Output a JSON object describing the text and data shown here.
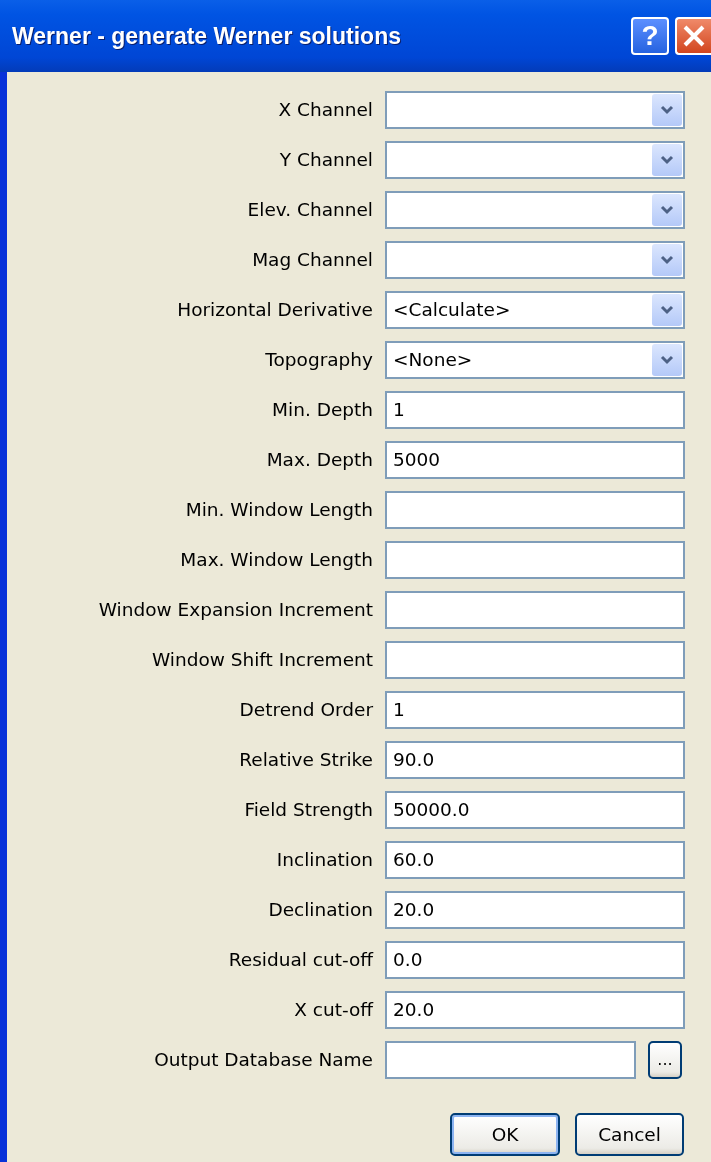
{
  "window": {
    "title": "Werner - generate Werner solutions",
    "help_button": "?"
  },
  "fields": [
    {
      "label": "X Channel",
      "kind": "combo"
    },
    {
      "label": "Y Channel",
      "kind": "combo"
    },
    {
      "label": "Elev. Channel",
      "kind": "combo"
    },
    {
      "label": "Mag Channel",
      "kind": "combo"
    },
    {
      "label": "Horizontal Derivative",
      "kind": "combo",
      "value": "<Calculate>"
    },
    {
      "label": "Topography",
      "kind": "combo",
      "value": "<None>"
    },
    {
      "label": "Min. Depth",
      "kind": "text",
      "value": "1"
    },
    {
      "label": "Max. Depth",
      "kind": "text",
      "value": "5000"
    },
    {
      "label": "Min. Window Length",
      "kind": "text"
    },
    {
      "label": "Max. Window Length",
      "kind": "text"
    },
    {
      "label": "Window Expansion Increment",
      "kind": "text"
    },
    {
      "label": "Window Shift Increment",
      "kind": "text"
    },
    {
      "label": "Detrend Order",
      "kind": "text",
      "value": "1"
    },
    {
      "label": "Relative Strike",
      "kind": "text",
      "value": "90.0"
    },
    {
      "label": "Field Strength",
      "kind": "text",
      "value": "50000.0"
    },
    {
      "label": "Inclination",
      "kind": "text",
      "value": "60.0"
    },
    {
      "label": "Declination",
      "kind": "text",
      "value": "20.0"
    },
    {
      "label": "Residual cut-off",
      "kind": "text",
      "value": "0.0"
    },
    {
      "label": "X cut-off",
      "kind": "text",
      "value": "20.0"
    },
    {
      "label": "Output Database Name",
      "kind": "file",
      "browse": "..."
    }
  ],
  "buttons": [
    "OK",
    "Cancel"
  ]
}
